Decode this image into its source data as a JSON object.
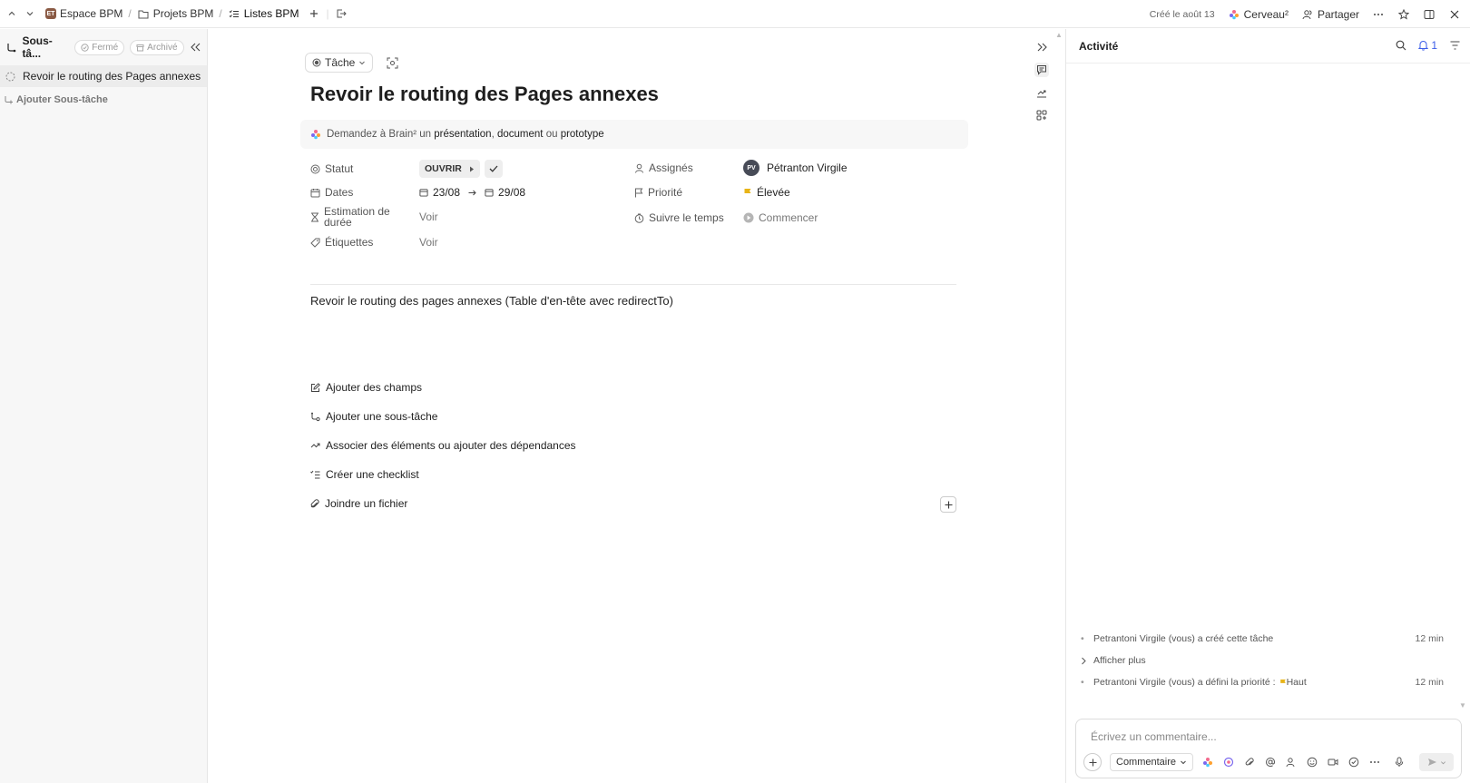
{
  "topbar": {
    "breadcrumb": [
      {
        "label": "Espace BPM",
        "badge": "ET",
        "icon": "space-icon"
      },
      {
        "label": "Projets BPM",
        "icon": "folder-icon"
      },
      {
        "label": "Listes BPM",
        "icon": "list-icon"
      }
    ],
    "created": "Créé le août 13",
    "brain_label": "Cerveau²",
    "share_label": "Partager"
  },
  "sidebar": {
    "title": "Sous-tâ...",
    "closed_label": "Fermé",
    "archived_label": "Archivé",
    "items": [
      {
        "label": "Revoir le routing des Pages annexes"
      }
    ],
    "add_label": "Ajouter Sous-tâche"
  },
  "task": {
    "type_label": "Tâche",
    "title": "Revoir le routing des Pages annexes",
    "brain_prompt": {
      "prefix": "Demandez à Brain² un",
      "opt1": "présentation",
      "comma": ",",
      "opt2": "document",
      "or": "ou",
      "opt3": "prototype"
    },
    "fields": {
      "status_label": "Statut",
      "status_value": "OUVRIR",
      "dates_label": "Dates",
      "date_start": "23/08",
      "date_end": "29/08",
      "estimate_label_1": "Estimation de",
      "estimate_label_2": "durée",
      "estimate_value": "Voir",
      "tags_label": "Étiquettes",
      "tags_value": "Voir",
      "assignees_label": "Assignés",
      "assignee_initials": "PV",
      "assignee_name": "Pétranton Virgile",
      "priority_label": "Priorité",
      "priority_value": "Élevée",
      "time_label": "Suivre le temps",
      "time_value": "Commencer"
    },
    "description": "Revoir le routing des pages annexes (Table d'en-tête avec redirectTo)",
    "actions": [
      "Ajouter des champs",
      "Ajouter une sous-tâche",
      "Associer des éléments ou ajouter des dépendances",
      "Créer une checklist",
      "Joindre un fichier"
    ]
  },
  "activity": {
    "title": "Activité",
    "notif_count": "1",
    "log": [
      {
        "text": "Petrantoni Virgile (vous) a créé cette tâche",
        "time": "12 min"
      },
      {
        "text": "Afficher plus"
      },
      {
        "text": "Petrantoni Virgile (vous) a défini la priorité :",
        "flag_text": "Haut",
        "time": "12 min"
      }
    ],
    "comment_placeholder": "Écrivez un commentaire...",
    "comment_type": "Commentaire"
  },
  "colors": {
    "accent": "#3a5ce8",
    "priority": "#e8b417",
    "avatar": "#474b57"
  }
}
